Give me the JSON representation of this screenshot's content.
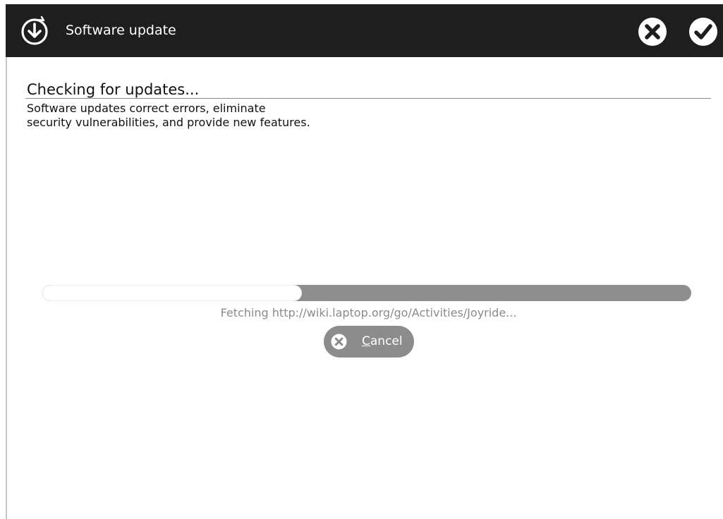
{
  "window": {
    "title": "Software update",
    "icon": "software-update-icon",
    "toolbar": {
      "cancel_icon": "close-icon",
      "ok_icon": "checkmark-icon"
    }
  },
  "content": {
    "heading": "Checking for updates...",
    "description_line1": "Software updates correct errors, eliminate",
    "description_line2": "security vulnerabilities, and provide new features.",
    "progress": {
      "fraction": 0.4,
      "status": "Fetching http://wiki.laptop.org/go/Activities/Joyride..."
    },
    "cancel_button": {
      "mnemonic": "C",
      "rest": "ancel",
      "icon": "close-icon"
    }
  },
  "colors": {
    "titlebar": "#1e1e1e",
    "progress_track": "#8e8e8e",
    "button_background": "#8c8c8c",
    "status_text": "#8a8a8a"
  }
}
